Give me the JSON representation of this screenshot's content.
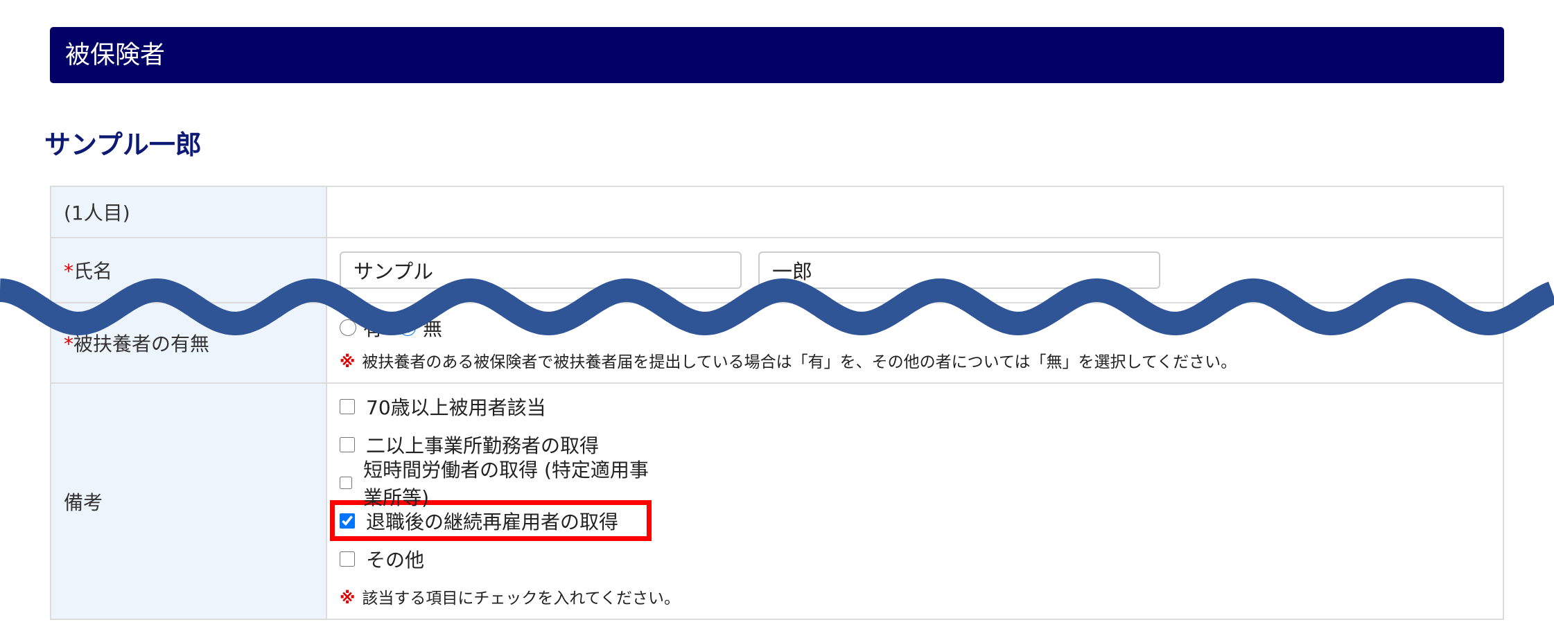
{
  "section": {
    "title": "被保険者"
  },
  "person": {
    "display_name": "サンプル一郎"
  },
  "rows": {
    "index": {
      "label": "(1人目)"
    },
    "name": {
      "required_mark": "*",
      "label": "氏名",
      "last_name": "サンプル",
      "first_name": "一郎"
    },
    "dependents": {
      "required_mark": "*",
      "label": "被扶養者の有無",
      "options": [
        "有",
        "無"
      ],
      "selected": "無",
      "note_mark": "※",
      "note": "被扶養者のある被保険者で被扶養者届を提出している場合は「有」を、その他の者については「無」を選択してください。"
    },
    "remarks": {
      "label": "備考",
      "items": [
        {
          "label": "70歳以上被用者該当",
          "checked": false
        },
        {
          "label": "二以上事業所勤務者の取得",
          "checked": false
        },
        {
          "label": "短時間労働者の取得 (特定適用事業所等)",
          "checked": false
        },
        {
          "label": "退職後の継続再雇用者の取得",
          "checked": true
        },
        {
          "label": "その他",
          "checked": false
        }
      ],
      "note_mark": "※",
      "note": "該当する項目にチェックを入れてください。"
    }
  },
  "colors": {
    "header_bg": "#000066",
    "name_color": "#0d1a73",
    "label_bg": "#edf4fc",
    "required": "#e00000",
    "highlight": "#ff0000",
    "wave": "#2f5597"
  },
  "icons": {
    "wave": "wavy-line-icon"
  }
}
